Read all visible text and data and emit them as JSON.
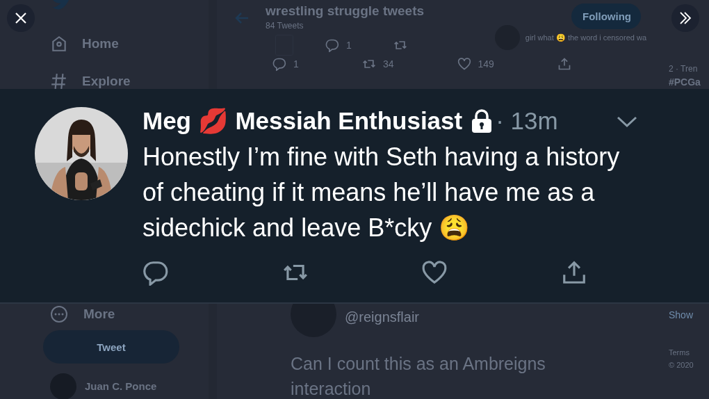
{
  "sidebar": {
    "items": [
      {
        "kind": "home",
        "label": "Home"
      },
      {
        "kind": "explore",
        "label": "Explore"
      }
    ],
    "more": "More",
    "tweet_button": "Tweet",
    "account_name": "Juan C. Ponce"
  },
  "header": {
    "title": "wrestling struggle tweets",
    "subtitle": "84 Tweets",
    "follow_button": "Following"
  },
  "timeline_top": {
    "first_actions": [
      {
        "kind": "reply",
        "count": "1"
      },
      {
        "kind": "retweet"
      }
    ],
    "quoted_text": "girl what 😩 the word i censored wa",
    "actions": [
      {
        "kind": "reply",
        "count": "1"
      },
      {
        "kind": "retweet",
        "count": "34"
      },
      {
        "kind": "like",
        "count": "149"
      },
      {
        "kind": "share"
      }
    ]
  },
  "image_tweet": {
    "name": "Meg 💋 Messiah Enthusiast",
    "protected": true,
    "time": "· 13m",
    "text": "Honestly I’m fine with Seth having a history of cheating if it means he’ll have me as a sidechick and leave B*cky 😩",
    "actions": [
      {
        "kind": "reply"
      },
      {
        "kind": "retweet"
      },
      {
        "kind": "like"
      },
      {
        "kind": "share"
      }
    ]
  },
  "reply_below": {
    "handle": "@reignsflair",
    "text": "Can I count this as an Ambreigns interaction"
  },
  "right_column": {
    "trend_meta": "2 · Tren",
    "trend": "#PCGa",
    "show_more": "Show",
    "terms": "Terms",
    "copyright": "© 2020"
  }
}
